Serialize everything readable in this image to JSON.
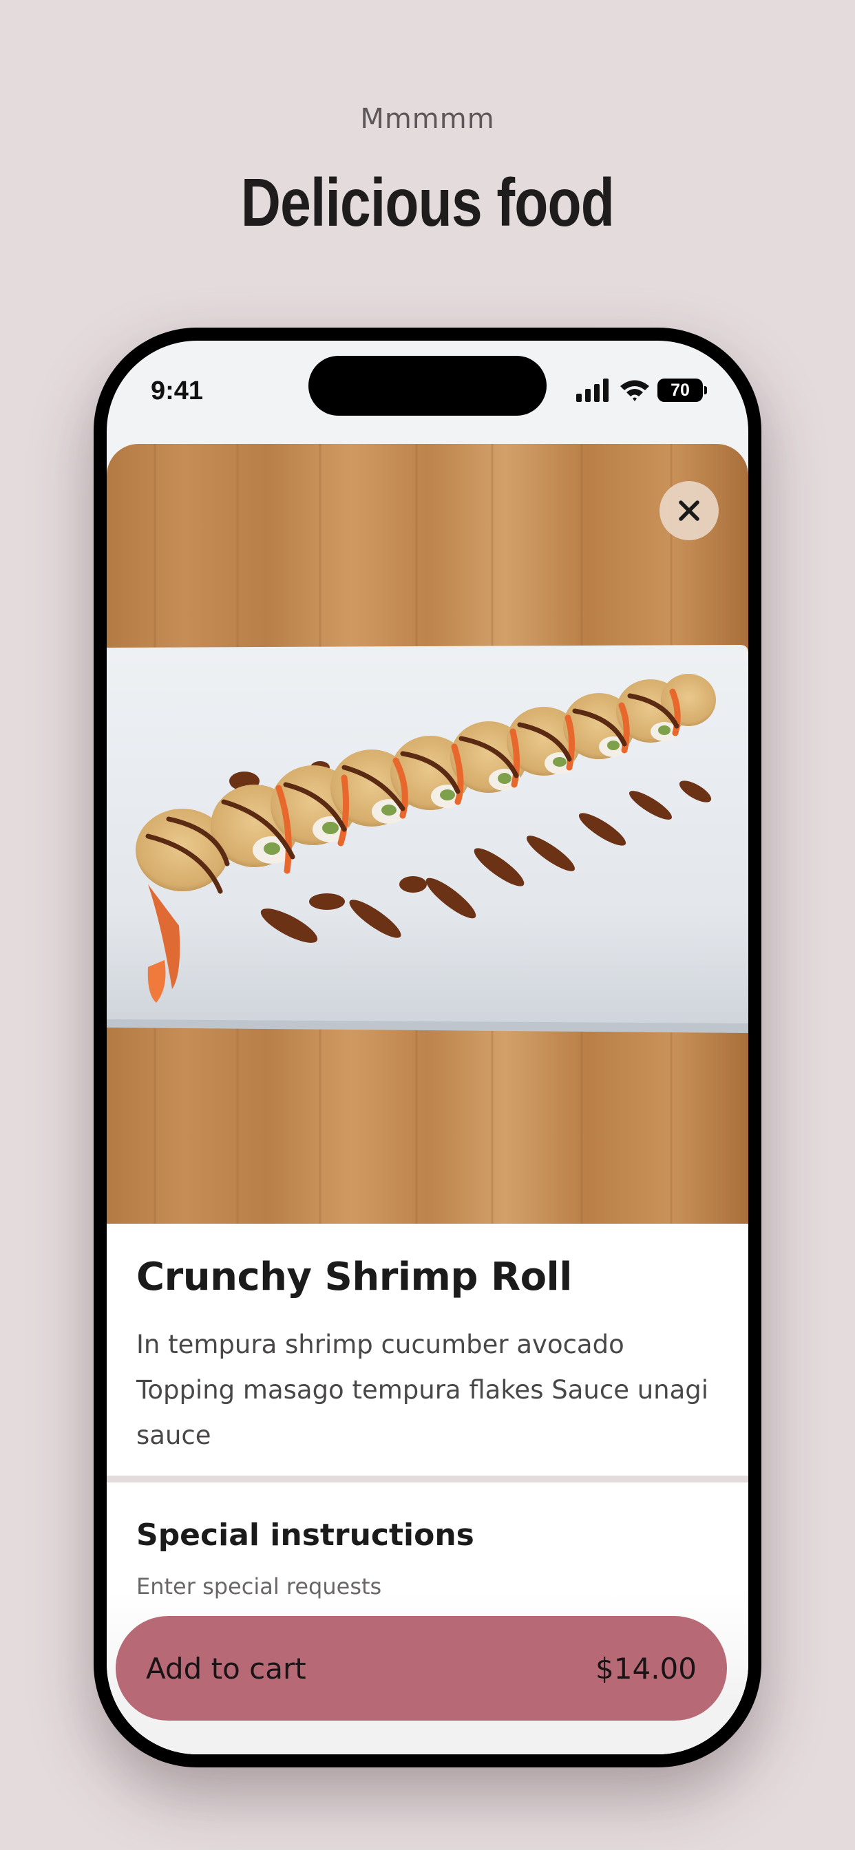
{
  "header": {
    "eyebrow": "Mmmmm",
    "title": "Delicious food"
  },
  "status_bar": {
    "time": "9:41",
    "battery": "70",
    "icons": [
      "signal-icon",
      "wifi-icon",
      "battery-icon"
    ]
  },
  "item": {
    "image_alt_icon": "sushi-roll-photo",
    "close_icon": "close-icon",
    "name": "Crunchy Shrimp Roll",
    "description": "In tempura shrimp cucumber avocado Topping masago tempura flakes Sauce unagi sauce"
  },
  "special_instructions": {
    "title": "Special instructions",
    "placeholder": "Enter special requests"
  },
  "cart": {
    "label": "Add to cart",
    "price": "$14.00"
  },
  "colors": {
    "background": "#e4dbdd",
    "accent": "#b76a76",
    "text": "#1c1b1b"
  }
}
